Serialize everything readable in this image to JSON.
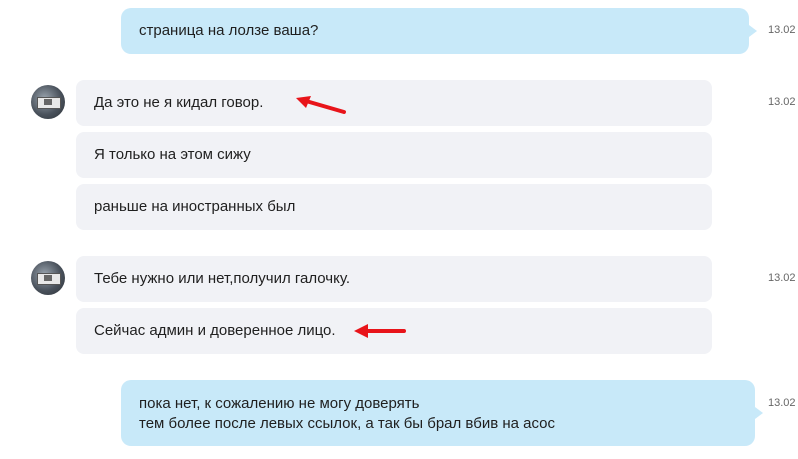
{
  "messages": [
    {
      "text": "страница на лолзе ваша?",
      "time": "13.02"
    },
    {
      "text": "Да это не я кидал говор.",
      "time": "13.02"
    },
    {
      "text": "Я только на этом сижу"
    },
    {
      "text": "раньше на иностранных был"
    },
    {
      "text": "Тебе нужно или нет,получил галочку.",
      "time": "13.02"
    },
    {
      "text": "Сейчас админ и доверенное лицо."
    },
    {
      "lines": [
        "пока нет, к сожалению не могу доверять",
        "тем более после левых ссылок, а так бы брал вбив на асос"
      ],
      "time": "13.02"
    }
  ],
  "icons": {
    "avatar": "user-avatar",
    "annotation": "red-arrow-annotation"
  },
  "colors": {
    "outgoing_bubble": "#c8e9f9",
    "incoming_bubble": "#f1f2f6",
    "annotation": "#e8141a"
  }
}
